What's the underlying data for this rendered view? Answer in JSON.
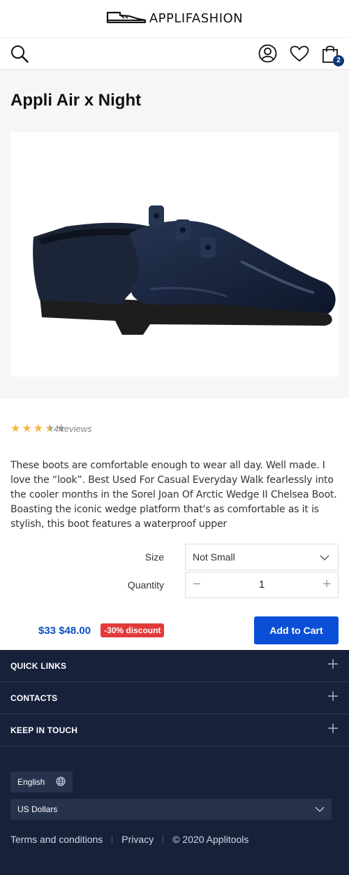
{
  "header": {
    "brand": "APPLIFASHION",
    "cart_count": "2",
    "icons": [
      "search-icon",
      "user-icon",
      "heart-icon",
      "bag-icon"
    ]
  },
  "product": {
    "title": "Appli Air x Night",
    "rating": 3.5,
    "rating_max": 5,
    "reviews": "4 reviews",
    "description": "These boots are comfortable enough to wear all day. Well made. I love the “look”. Best Used For Casual Everyday Walk fearlessly into the cooler months in the Sorel Joan Of Arctic Wedge II Chelsea Boot. Boasting the iconic wedge platform that's as comfortable as it is stylish, this boot features a waterproof upper",
    "size_label": "Size",
    "size_value": "Not Small",
    "quantity_label": "Quantity",
    "quantity_value": "1",
    "price": "$33 $48.00",
    "discount": "-30% discount",
    "add_to_cart": "Add to Cart"
  },
  "footer": {
    "sections": [
      {
        "title": "QUICK LINKS"
      },
      {
        "title": "CONTACTS"
      },
      {
        "title": "KEEP IN TOUCH"
      }
    ],
    "language": "English",
    "currency": "US Dollars",
    "links": [
      "Terms and conditions",
      "Privacy"
    ],
    "copyright": "© 2020 Applitools"
  },
  "colors": {
    "accent": "#0a4fd6",
    "price": "#0c52c4",
    "discount": "#e23a3a",
    "footer_bg": "#18213a",
    "star": "#f6b93b"
  }
}
